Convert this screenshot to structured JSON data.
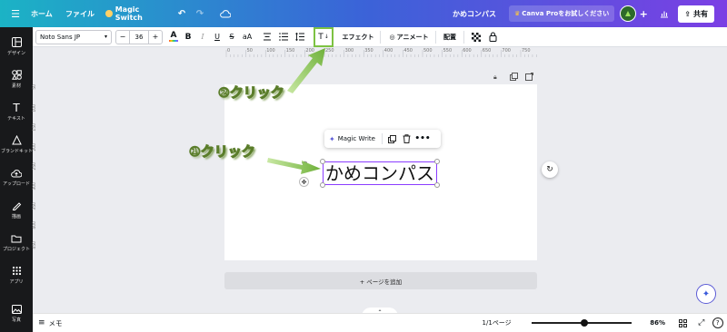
{
  "topbar": {
    "home": "ホーム",
    "file": "ファイル",
    "magic_switch": "Magic Switch",
    "doc_title": "かめコンパス",
    "pro_trial": "Canva Proをお試しください",
    "share": "共有"
  },
  "sidebar": {
    "items": [
      {
        "label": "デザイン",
        "icon": "design-icon"
      },
      {
        "label": "素材",
        "icon": "elements-icon"
      },
      {
        "label": "テキスト",
        "icon": "text-icon"
      },
      {
        "label": "ブランドキット",
        "icon": "brand-icon"
      },
      {
        "label": "アップロード",
        "icon": "upload-icon"
      },
      {
        "label": "描画",
        "icon": "draw-icon"
      },
      {
        "label": "プロジェクト",
        "icon": "folder-icon"
      },
      {
        "label": "アプリ",
        "icon": "apps-icon"
      },
      {
        "label": "写真",
        "icon": "photo-icon"
      }
    ]
  },
  "toolbar": {
    "font": "Noto Sans JP",
    "font_size": "36",
    "bold": "B",
    "italic": "I",
    "underline": "U",
    "strike": "S",
    "case": "aA",
    "effects": "エフェクト",
    "animate": "アニメート",
    "position": "配置",
    "text_tool": "T"
  },
  "ruler": {
    "top": [
      "0",
      "50",
      "100",
      "150",
      "200",
      "250",
      "300",
      "350",
      "400",
      "450",
      "500",
      "550",
      "600",
      "650",
      "700",
      "750"
    ],
    "left": [
      "50",
      "100",
      "150",
      "200",
      "250",
      "300",
      "350",
      "400",
      "450"
    ]
  },
  "canvas": {
    "text": "かめコンパス",
    "magic_write": "Magic Write",
    "add_page": "+ ページを追加"
  },
  "annotations": {
    "step1": "①クリック",
    "step2": "②クリック"
  },
  "bottombar": {
    "notes": "メモ",
    "page": "1/1ページ",
    "zoom": "86%",
    "zoom_fraction": 0.86
  },
  "colors": {
    "accent": "#8b3dff",
    "annotation": "#7dc242"
  }
}
